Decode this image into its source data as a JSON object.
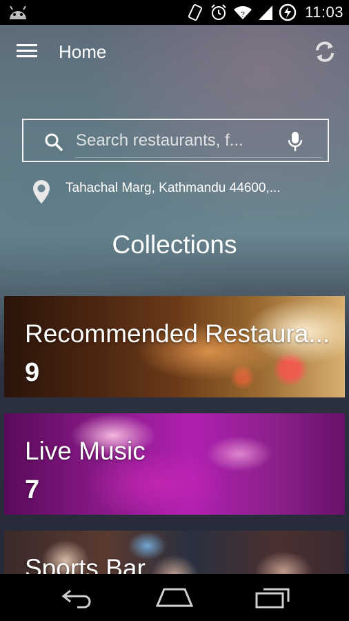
{
  "status_bar": {
    "time": "11:03",
    "icons": [
      "android-icon",
      "vibrate-icon",
      "alarm-icon",
      "wifi-icon",
      "signal-icon",
      "battery-charging-icon"
    ]
  },
  "toolbar": {
    "title": "Home",
    "menu_icon": "hamburger-menu-icon",
    "refresh_icon": "refresh-icon"
  },
  "search": {
    "placeholder": "Search restaurants, f...",
    "value": ""
  },
  "location": {
    "text": "Tahachal Marg, Kathmandu 44600,..."
  },
  "collections": {
    "title": "Collections",
    "items": [
      {
        "title": "Recommended Restaura...",
        "count": "9"
      },
      {
        "title": "Live Music",
        "count": "7"
      },
      {
        "title": "Sports Bar",
        "count": ""
      }
    ]
  },
  "nav_bar": {
    "icons": [
      "back-icon",
      "home-icon",
      "recents-icon"
    ]
  },
  "colors": {
    "text": "#ffffff",
    "status_bar_bg": "#000000",
    "nav_bar_bg": "#000000"
  }
}
